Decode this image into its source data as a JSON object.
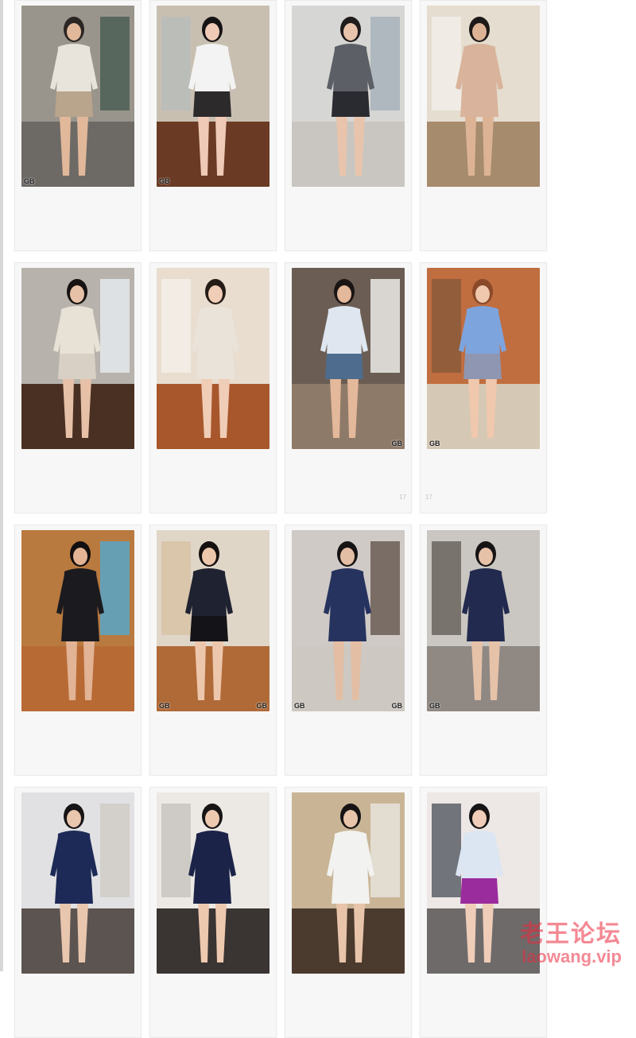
{
  "brand": {
    "name_cn": "老王论坛",
    "url": "laowang.vip"
  },
  "cards": [
    {
      "wall": "#9a958c",
      "floor": "#6d6a66",
      "accent": "#4c5f56",
      "top": "#e8e4dc",
      "bottom": "#b9a58c",
      "skin": "#e2b89a",
      "hair": "#2b2624",
      "wm_left": "GB",
      "wm_right": "",
      "cap_left": "",
      "cap_right": ""
    },
    {
      "wall": "#c9bfb1",
      "floor": "#6a3a24",
      "accent": "#b9bcbb",
      "top": "#f3f3f3",
      "bottom": "#2d2a2c",
      "skin": "#efcab6",
      "hair": "#161315",
      "wm_left": "GB",
      "wm_right": "",
      "cap_left": "",
      "cap_right": ""
    },
    {
      "wall": "#d6d6d4",
      "floor": "#c9c6c1",
      "accent": "#a8b3ba",
      "top": "#5c5f66",
      "bottom": "#2a2b31",
      "skin": "#e9c4ac",
      "hair": "#201c1b",
      "wm_left": "",
      "wm_right": "",
      "cap_left": "",
      "cap_right": ""
    },
    {
      "wall": "#e5ddcf",
      "floor": "#a68b6d",
      "accent": "#f2efe9",
      "top": "#d9b39b",
      "bottom": "#d9b39b",
      "skin": "#ddb396",
      "hair": "#1e1a19",
      "wm_left": "",
      "wm_right": "",
      "cap_left": "",
      "cap_right": ""
    },
    {
      "wall": "#b7b2ab",
      "floor": "#4a3022",
      "accent": "#e4e9ec",
      "top": "#e7e1d6",
      "bottom": "#d8d0c4",
      "skin": "#e6c1a8",
      "hair": "#171312",
      "wm_left": "",
      "wm_right": "",
      "cap_left": "",
      "cap_right": ""
    },
    {
      "wall": "#e8ddcf",
      "floor": "#a8572d",
      "accent": "#f3efe9",
      "top": "#eae3da",
      "bottom": "#eae3da",
      "skin": "#f0cdb6",
      "hair": "#251c17",
      "wm_left": "",
      "wm_right": "",
      "cap_left": "",
      "cap_right": ""
    },
    {
      "wall": "#6b5d53",
      "floor": "#8e7a68",
      "accent": "#ecebe8",
      "top": "#dfe6ef",
      "bottom": "#4e6c8e",
      "skin": "#e4b89a",
      "hair": "#1a1514",
      "wm_left": "",
      "wm_right": "GB",
      "cap_left": "",
      "cap_right": "17"
    },
    {
      "wall": "#c06d3f",
      "floor": "#d5c8b5",
      "accent": "#8a5a3a",
      "top": "#7ea4dd",
      "bottom": "#8e96b1",
      "skin": "#efc8ad",
      "hair": "#8a4a2a",
      "wm_left": "GB",
      "wm_right": "",
      "cap_left": "17",
      "cap_right": ""
    },
    {
      "wall": "#b97a3f",
      "floor": "#b86a35",
      "accent": "#57a6c9",
      "top": "#1b1b1f",
      "bottom": "#1b1b1f",
      "skin": "#e2b394",
      "hair": "#120f10",
      "wm_left": "",
      "wm_right": "",
      "cap_left": "",
      "cap_right": ""
    },
    {
      "wall": "#e0d6c8",
      "floor": "#b06a38",
      "accent": "#d7c3a6",
      "top": "#1f2230",
      "bottom": "#141418",
      "skin": "#edc7ac",
      "hair": "#15110f",
      "wm_left": "GB",
      "wm_right": "GB",
      "cap_left": "",
      "cap_right": ""
    },
    {
      "wall": "#cfcac6",
      "floor": "#cdc8c1",
      "accent": "#6b5d55",
      "top": "#27335f",
      "bottom": "#27335f",
      "skin": "#e3bea4",
      "hair": "#161314",
      "wm_left": "GB",
      "wm_right": "GB",
      "cap_left": "",
      "cap_right": ""
    },
    {
      "wall": "#cac6c1",
      "floor": "#8f8883",
      "accent": "#6b645f",
      "top": "#222a4f",
      "bottom": "#222a4f",
      "skin": "#e6c2a9",
      "hair": "#161314",
      "wm_left": "GB",
      "wm_right": "",
      "cap_left": "",
      "cap_right": ""
    },
    {
      "wall": "#e1e1e3",
      "floor": "#5c5450",
      "accent": "#d0cbc5",
      "top": "#1d2a57",
      "bottom": "#1d2a57",
      "skin": "#e9c6ae",
      "hair": "#171415",
      "wm_left": "",
      "wm_right": "",
      "cap_left": "",
      "cap_right": ""
    },
    {
      "wall": "#ece9e4",
      "floor": "#3a3432",
      "accent": "#c9c6c1",
      "top": "#1b2348",
      "bottom": "#1b2348",
      "skin": "#edc9b0",
      "hair": "#171415",
      "wm_left": "",
      "wm_right": "",
      "cap_left": "",
      "cap_right": ""
    },
    {
      "wall": "#c9b596",
      "floor": "#4b3a2e",
      "accent": "#e7e3dc",
      "top": "#f2f2f0",
      "bottom": "#f2f2f0",
      "skin": "#e8c4aa",
      "hair": "#181415",
      "wm_left": "",
      "wm_right": "",
      "cap_left": "",
      "cap_right": ""
    },
    {
      "wall": "#ede7e6",
      "floor": "#6e6a6a",
      "accent": "#5b5f66",
      "top": "#dce6f2",
      "bottom": "#9a2c9d",
      "skin": "#efcdb8",
      "hair": "#171415",
      "wm_left": "",
      "wm_right": "",
      "cap_left": "",
      "cap_right": ""
    }
  ]
}
